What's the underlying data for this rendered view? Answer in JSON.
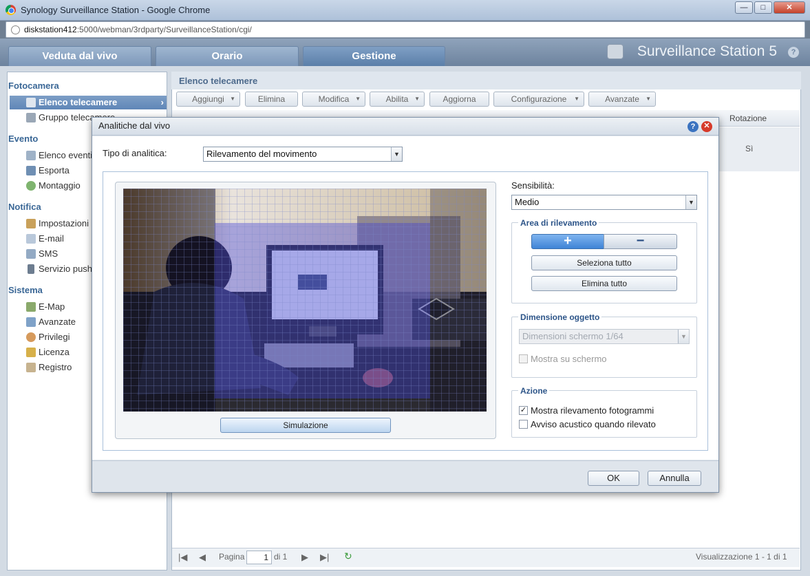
{
  "browser": {
    "title": "Synology Surveillance Station - Google Chrome",
    "url_host": "diskstation412",
    "url_rest": ":5000/webman/3rdparty/SurveillanceStation/cgi/",
    "minimize": "—",
    "maximize": "□",
    "close": "✕"
  },
  "app": {
    "tabs": [
      "Veduta dal vivo",
      "Orario",
      "Gestione"
    ],
    "active_tab": "Gestione",
    "brand": "Surveillance Station 5",
    "help": "?"
  },
  "sidebar": {
    "sections": [
      {
        "title": "Fotocamera",
        "items": [
          {
            "label": "Elenco telecamere",
            "icon": "camera-icon",
            "selected": true
          },
          {
            "label": "Gruppo telecamere",
            "icon": "camera-group-icon"
          }
        ]
      },
      {
        "title": "Evento",
        "items": [
          {
            "label": "Elenco eventi",
            "icon": "list-icon"
          },
          {
            "label": "Esporta",
            "icon": "export-icon"
          },
          {
            "label": "Montaggio",
            "icon": "montage-icon"
          }
        ]
      },
      {
        "title": "Notifica",
        "items": [
          {
            "label": "Impostazioni",
            "icon": "wrench-icon"
          },
          {
            "label": "E-mail",
            "icon": "mail-icon"
          },
          {
            "label": "SMS",
            "icon": "sms-icon"
          },
          {
            "label": "Servizio push",
            "icon": "mobile-icon"
          }
        ]
      },
      {
        "title": "Sistema",
        "items": [
          {
            "label": "E-Map",
            "icon": "map-icon"
          },
          {
            "label": "Avanzate",
            "icon": "advanced-icon"
          },
          {
            "label": "Privilegi",
            "icon": "users-icon"
          },
          {
            "label": "Licenza",
            "icon": "key-icon"
          },
          {
            "label": "Registro",
            "icon": "book-icon"
          }
        ]
      }
    ]
  },
  "main": {
    "title": "Elenco telecamere",
    "toolbar": [
      {
        "label": "Aggiungi",
        "dropdown": true
      },
      {
        "label": "Elimina",
        "dropdown": false
      },
      {
        "label": "Modifica",
        "dropdown": true
      },
      {
        "label": "Abilita",
        "dropdown": true
      },
      {
        "label": "Aggiorna",
        "dropdown": false
      },
      {
        "label": "Configurazione",
        "dropdown": true
      },
      {
        "label": "Avanzate",
        "dropdown": true
      }
    ],
    "column_rotation": "Rotazione",
    "cell_rotation": "Sì",
    "pager": {
      "page_label": "Pagina",
      "page_value": "1",
      "of_label": "di 1",
      "display": "Visualizzazione 1 - 1 di 1"
    }
  },
  "dialog": {
    "title": "Analitiche dal vivo",
    "analytics_type_label": "Tipo di analitica:",
    "analytics_type_value": "Rilevamento del movimento",
    "sensitivity_label": "Sensibilità:",
    "sensitivity_value": "Medio",
    "detection_area": {
      "legend": "Area di rilevamento",
      "add": "+",
      "remove": "−",
      "select_all": "Seleziona tutto",
      "delete_all": "Elimina tutto"
    },
    "object_size": {
      "legend": "Dimensione oggetto",
      "value": "Dimensioni schermo 1/64",
      "show_on_screen": "Mostra su schermo",
      "show_checked": false
    },
    "action": {
      "legend": "Azione",
      "show_frames": "Mostra rilevamento fotogrammi",
      "show_frames_checked": true,
      "beep": "Avviso acustico quando rilevato",
      "beep_checked": false
    },
    "simulate": "Simulazione",
    "ok": "OK",
    "cancel": "Annulla"
  }
}
